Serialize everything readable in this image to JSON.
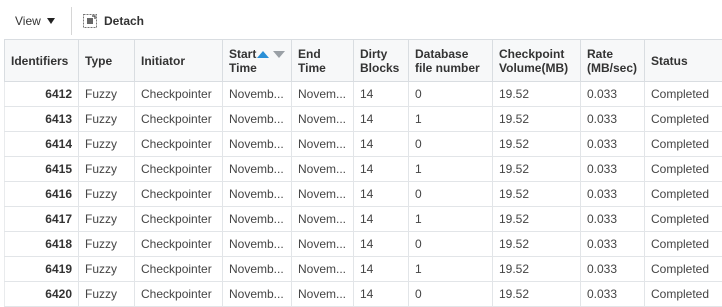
{
  "toolbar": {
    "view_label": "View",
    "detach_label": "Detach"
  },
  "table": {
    "headers": {
      "identifiers": "Identifiers",
      "type": "Type",
      "initiator": "Initiator",
      "start_time": "Start Time",
      "end_time": "End Time",
      "dirty_blocks": "Dirty Blocks",
      "db_file_number": "Database file number",
      "ckpt_volume": "Checkpoint Volume(MB)",
      "rate": "Rate (MB/sec)",
      "status": "Status"
    },
    "sort": {
      "column": "start_time",
      "direction": "ascending"
    },
    "rows": [
      {
        "id": "6412",
        "type": "Fuzzy",
        "initiator": "Checkpointer",
        "start": "Novemb...",
        "end": "Novem...",
        "dirty": "14",
        "file": "0",
        "volume": "19.52",
        "rate": "0.033",
        "status": "Completed"
      },
      {
        "id": "6413",
        "type": "Fuzzy",
        "initiator": "Checkpointer",
        "start": "Novemb...",
        "end": "Novem...",
        "dirty": "14",
        "file": "1",
        "volume": "19.52",
        "rate": "0.033",
        "status": "Completed"
      },
      {
        "id": "6414",
        "type": "Fuzzy",
        "initiator": "Checkpointer",
        "start": "Novemb...",
        "end": "Novem...",
        "dirty": "14",
        "file": "0",
        "volume": "19.52",
        "rate": "0.033",
        "status": "Completed"
      },
      {
        "id": "6415",
        "type": "Fuzzy",
        "initiator": "Checkpointer",
        "start": "Novemb...",
        "end": "Novem...",
        "dirty": "14",
        "file": "1",
        "volume": "19.52",
        "rate": "0.033",
        "status": "Completed"
      },
      {
        "id": "6416",
        "type": "Fuzzy",
        "initiator": "Checkpointer",
        "start": "Novemb...",
        "end": "Novem...",
        "dirty": "14",
        "file": "0",
        "volume": "19.52",
        "rate": "0.033",
        "status": "Completed"
      },
      {
        "id": "6417",
        "type": "Fuzzy",
        "initiator": "Checkpointer",
        "start": "Novemb...",
        "end": "Novem...",
        "dirty": "14",
        "file": "1",
        "volume": "19.52",
        "rate": "0.033",
        "status": "Completed"
      },
      {
        "id": "6418",
        "type": "Fuzzy",
        "initiator": "Checkpointer",
        "start": "Novemb...",
        "end": "Novem...",
        "dirty": "14",
        "file": "0",
        "volume": "19.52",
        "rate": "0.033",
        "status": "Completed"
      },
      {
        "id": "6419",
        "type": "Fuzzy",
        "initiator": "Checkpointer",
        "start": "Novemb...",
        "end": "Novem...",
        "dirty": "14",
        "file": "1",
        "volume": "19.52",
        "rate": "0.033",
        "status": "Completed"
      },
      {
        "id": "6420",
        "type": "Fuzzy",
        "initiator": "Checkpointer",
        "start": "Novemb...",
        "end": "Novem...",
        "dirty": "14",
        "file": "0",
        "volume": "19.52",
        "rate": "0.033",
        "status": "Completed"
      }
    ]
  },
  "colors": {
    "sort_active": "#2a8fd6",
    "sort_inactive": "#9aa0a6",
    "header_bg": "#f7f8f9",
    "border": "#d9dde1"
  }
}
